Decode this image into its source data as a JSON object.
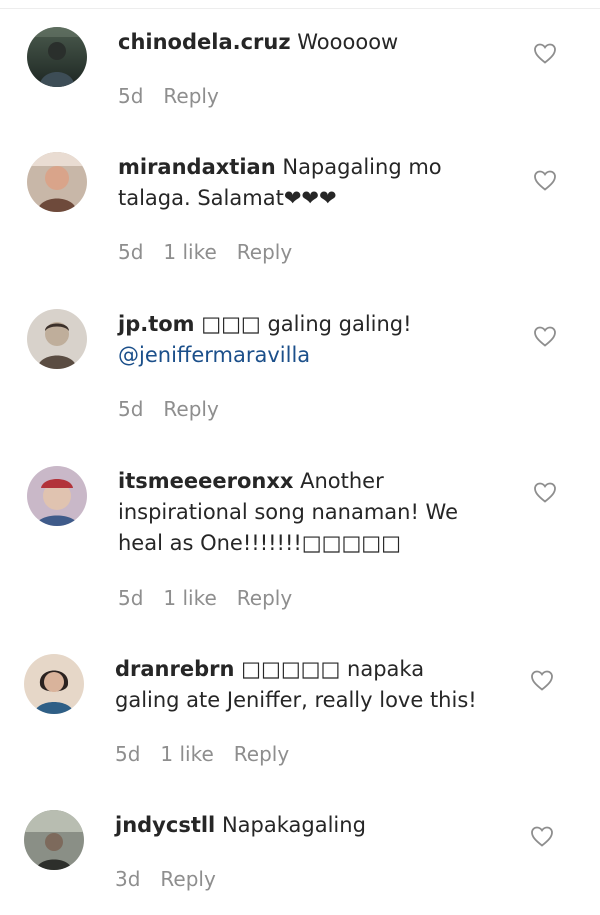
{
  "comments": [
    {
      "username": "chinodela.cruz",
      "text": "Wooooow",
      "mention": "",
      "age": "5d",
      "likes": "",
      "reply_label": "Reply",
      "avatar_colors": [
        "#3a4a3e",
        "#1d2622"
      ]
    },
    {
      "username": "mirandaxtian",
      "text": "Napagaling mo talaga. Salamat❤❤❤",
      "mention": "",
      "age": "5d",
      "likes": "1 like",
      "reply_label": "Reply",
      "avatar_colors": [
        "#d9a48a",
        "#6e4a3b"
      ]
    },
    {
      "username": "jp.tom",
      "text": "□□□ galing galing!",
      "mention": "@jeniffermaravilla",
      "age": "5d",
      "likes": "",
      "reply_label": "Reply",
      "avatar_colors": [
        "#bfae9b",
        "#5a4c42"
      ]
    },
    {
      "username": "itsmeeeeronxx",
      "text": "Another inspirational song nanaman! We heal as One!!!!!!!□□□□□",
      "mention": "",
      "age": "5d",
      "likes": "1 like",
      "reply_label": "Reply",
      "avatar_colors": [
        "#c9b8c8",
        "#b2333a"
      ]
    },
    {
      "username": "dranrebrn",
      "text": "□□□□□ napaka galing ate Jeniffer, really love this!",
      "mention": "",
      "age": "5d",
      "likes": "1 like",
      "reply_label": "Reply",
      "avatar_colors": [
        "#e6d7c8",
        "#2f5f86"
      ]
    },
    {
      "username": "jndycstll",
      "text": "Napakagaling",
      "mention": "",
      "age": "3d",
      "likes": "",
      "reply_label": "Reply",
      "avatar_colors": [
        "#8a8f86",
        "#2d2f2b"
      ]
    }
  ],
  "icons": {
    "like": "heart-outline-icon"
  },
  "colors": {
    "text": "#262626",
    "meta": "#8e8e8e",
    "mention": "#1b4f8a",
    "heart_stroke": "#8e8e8e"
  }
}
